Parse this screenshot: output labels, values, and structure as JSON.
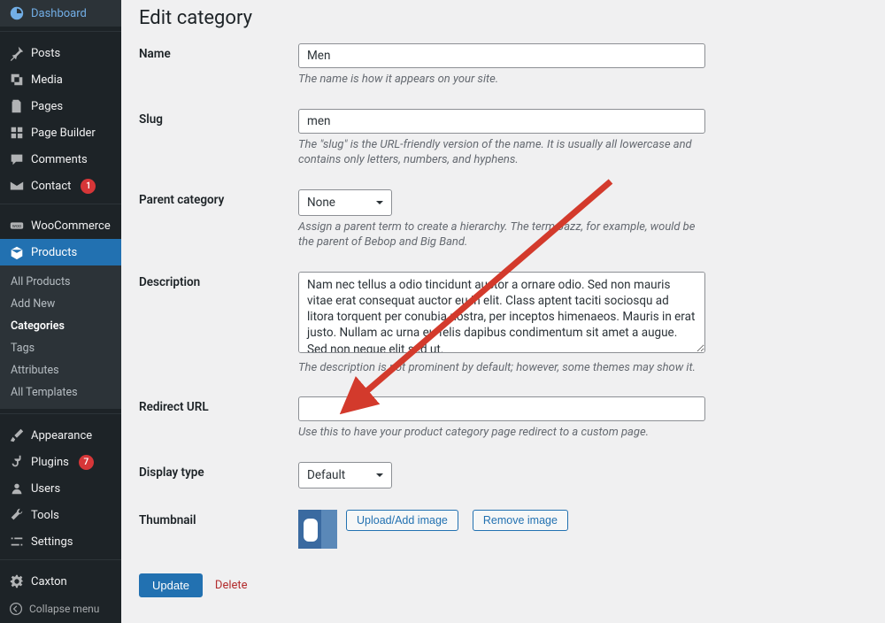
{
  "sidebar": {
    "dashboard": "Dashboard",
    "posts": "Posts",
    "media": "Media",
    "pages": "Pages",
    "page_builder": "Page Builder",
    "comments": "Comments",
    "contact": "Contact",
    "contact_badge": "1",
    "woocommerce": "WooCommerce",
    "products": "Products",
    "appearance": "Appearance",
    "plugins": "Plugins",
    "plugins_badge": "7",
    "users": "Users",
    "tools": "Tools",
    "settings": "Settings",
    "caxton": "Caxton",
    "collapse": "Collapse menu"
  },
  "submenu": {
    "all_products": "All Products",
    "add_new": "Add New",
    "categories": "Categories",
    "tags": "Tags",
    "attributes": "Attributes",
    "all_templates": "All Templates"
  },
  "page": {
    "title": "Edit category"
  },
  "form": {
    "name_label": "Name",
    "name_value": "Men",
    "name_description": "The name is how it appears on your site.",
    "slug_label": "Slug",
    "slug_value": "men",
    "slug_description": "The \"slug\" is the URL-friendly version of the name. It is usually all lowercase and contains only letters, numbers, and hyphens.",
    "parent_label": "Parent category",
    "parent_value": "None",
    "parent_description": "Assign a parent term to create a hierarchy. The term Jazz, for example, would be the parent of Bebop and Big Band.",
    "description_label": "Description",
    "description_value": "Nam nec tellus a odio tincidunt auctor a ornare odio. Sed non mauris vitae erat consequat auctor eu in elit. Class aptent taciti sociosqu ad litora torquent per conubia nostra, per inceptos himenaeos. Mauris in erat justo. Nullam ac urna eu felis dapibus condimentum sit amet a augue. Sed non neque elit sed ut.",
    "description_description": "The description is not prominent by default; however, some themes may show it.",
    "redirect_label": "Redirect URL",
    "redirect_value": "",
    "redirect_description": "Use this to have your product category page redirect to a custom page.",
    "display_label": "Display type",
    "display_value": "Default",
    "thumbnail_label": "Thumbnail",
    "upload_button": "Upload/Add image",
    "remove_button": "Remove image"
  },
  "actions": {
    "update": "Update",
    "delete": "Delete"
  },
  "colors": {
    "arrow": "#d33a2c"
  }
}
